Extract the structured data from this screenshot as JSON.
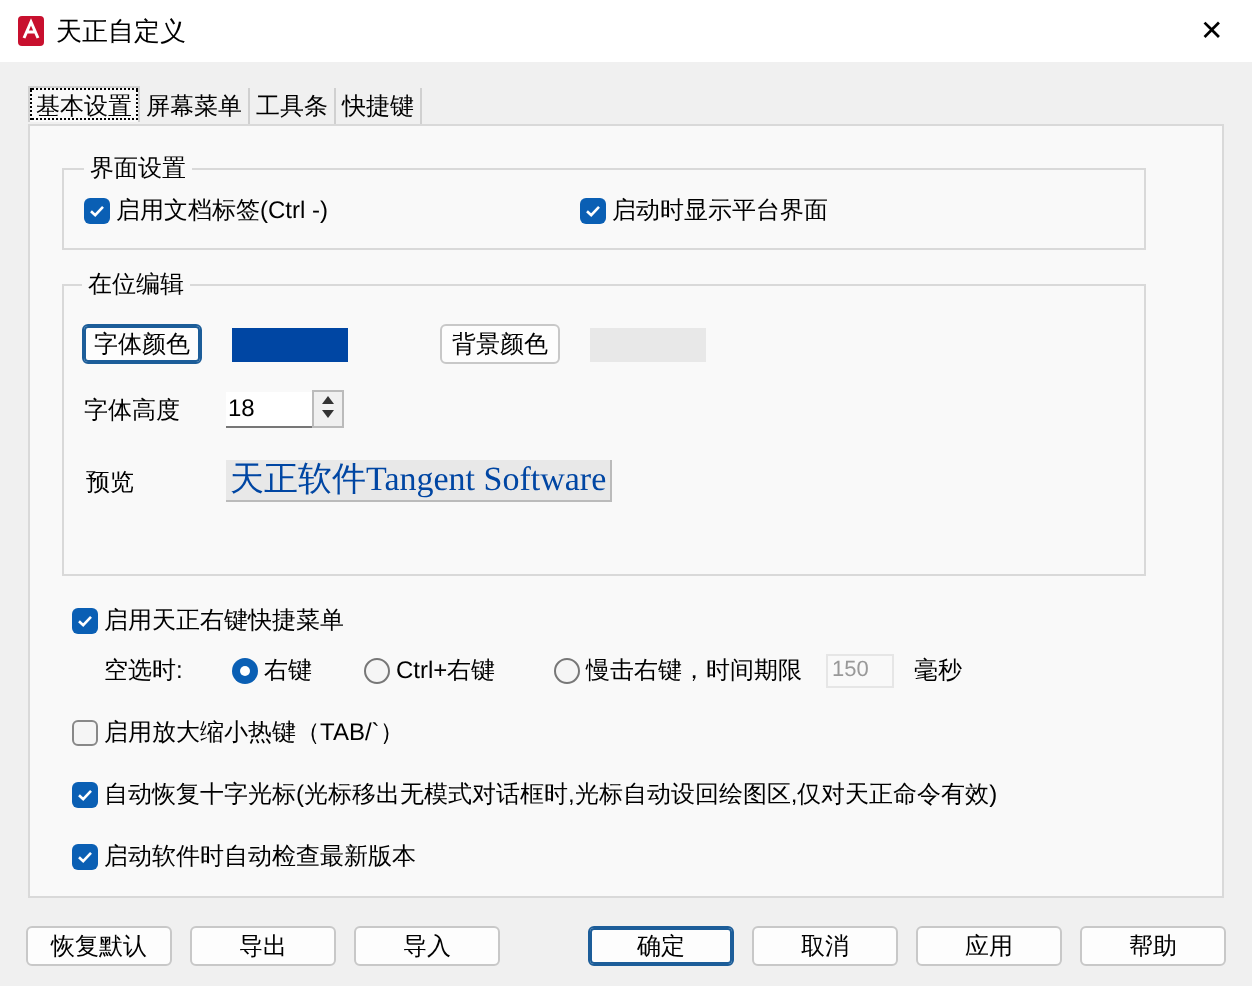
{
  "window": {
    "title": "天正自定义",
    "close": "✕"
  },
  "tabs": [
    {
      "label": "基本设置",
      "selected": true
    },
    {
      "label": "屏幕菜单",
      "selected": false
    },
    {
      "label": "工具条",
      "selected": false
    },
    {
      "label": "快捷键",
      "selected": false
    }
  ],
  "interface_group": {
    "title": "界面设置",
    "options": [
      {
        "label": "启用文档标签(Ctrl -)",
        "checked": true
      },
      {
        "label": "启动时显示平台界面",
        "checked": true
      }
    ]
  },
  "inplace_group": {
    "title": "在位编辑",
    "font_color": {
      "button": "字体颜色",
      "color": "#0046a3"
    },
    "background_color": {
      "button": "背景颜色",
      "color": "#e8e8e8"
    },
    "font_height": {
      "label": "字体高度",
      "value": "18"
    },
    "preview": {
      "label": "预览",
      "text": "天正软件Tangent Software"
    }
  },
  "right_click_menu": {
    "label": "启用天正右键快捷菜单",
    "checked": true,
    "empty_select_label": "空选时:",
    "modes": [
      {
        "label": "右键",
        "selected": true
      },
      {
        "label": "Ctrl+右键",
        "selected": false
      },
      {
        "label": "慢击右键，时间期限",
        "selected": false
      }
    ],
    "time_limit": "150",
    "time_unit": "毫秒"
  },
  "options": [
    {
      "label": "启用放大缩小热键（TAB/`）",
      "checked": false
    },
    {
      "label": "自动恢复十字光标(光标移出无模式对话框时,光标自动设回绘图区,仅对天正命令有效)",
      "checked": true
    },
    {
      "label": "启动软件时自动检查最新版本",
      "checked": true
    }
  ],
  "left_buttons": [
    "恢复默认",
    "导出",
    "导入"
  ],
  "right_buttons": [
    {
      "label": "确定",
      "default": true
    },
    {
      "label": "取消",
      "default": false
    },
    {
      "label": "应用",
      "default": false
    },
    {
      "label": "帮助",
      "default": false
    }
  ]
}
